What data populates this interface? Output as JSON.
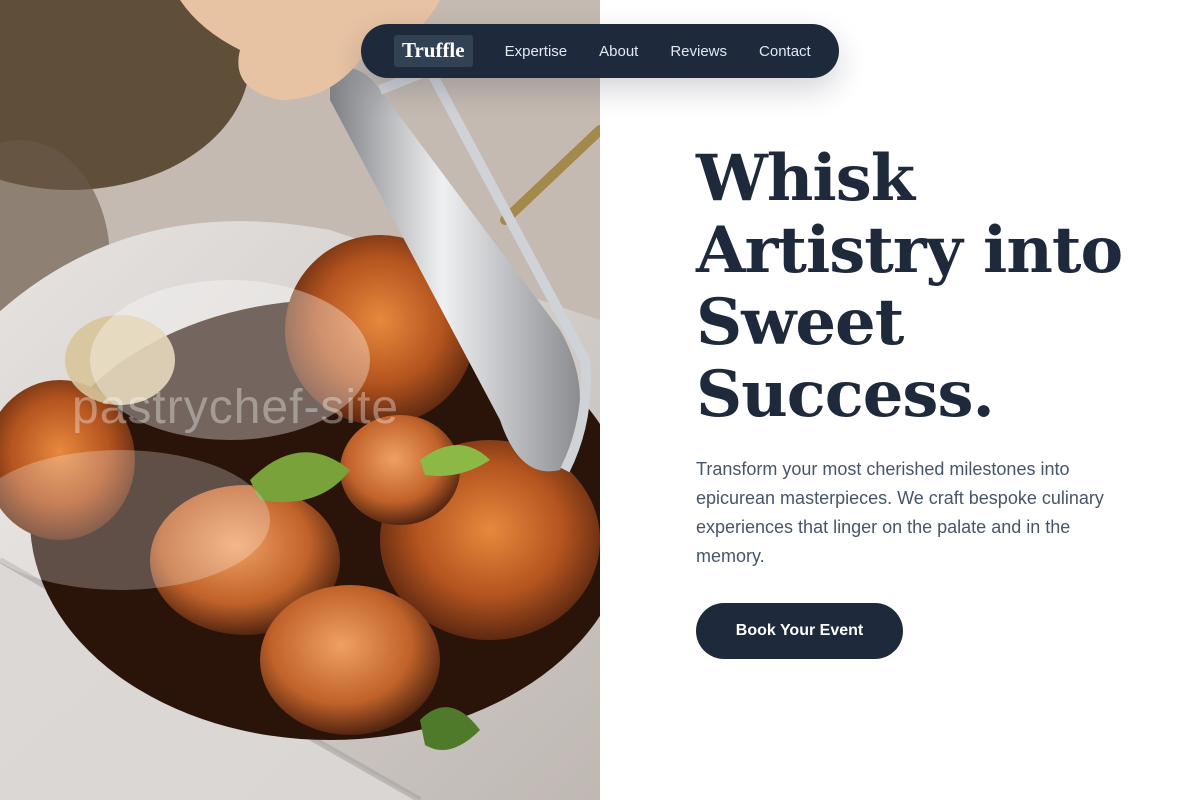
{
  "nav": {
    "brand": "Truffle",
    "links": [
      {
        "label": "Expertise"
      },
      {
        "label": "About"
      },
      {
        "label": "Reviews"
      },
      {
        "label": "Contact"
      }
    ]
  },
  "hero": {
    "image_watermark": "pastrychef-site",
    "title": "Whisk Artistry into Sweet Success.",
    "subtitle": "Transform your most cherished milestones into epicurean masterpieces. We craft bespoke culinary experiences that linger on the palate and in the memory.",
    "cta_label": "Book Your Event"
  },
  "colors": {
    "navy": "#1e293b",
    "text_muted": "#475569",
    "background": "#ffffff"
  }
}
